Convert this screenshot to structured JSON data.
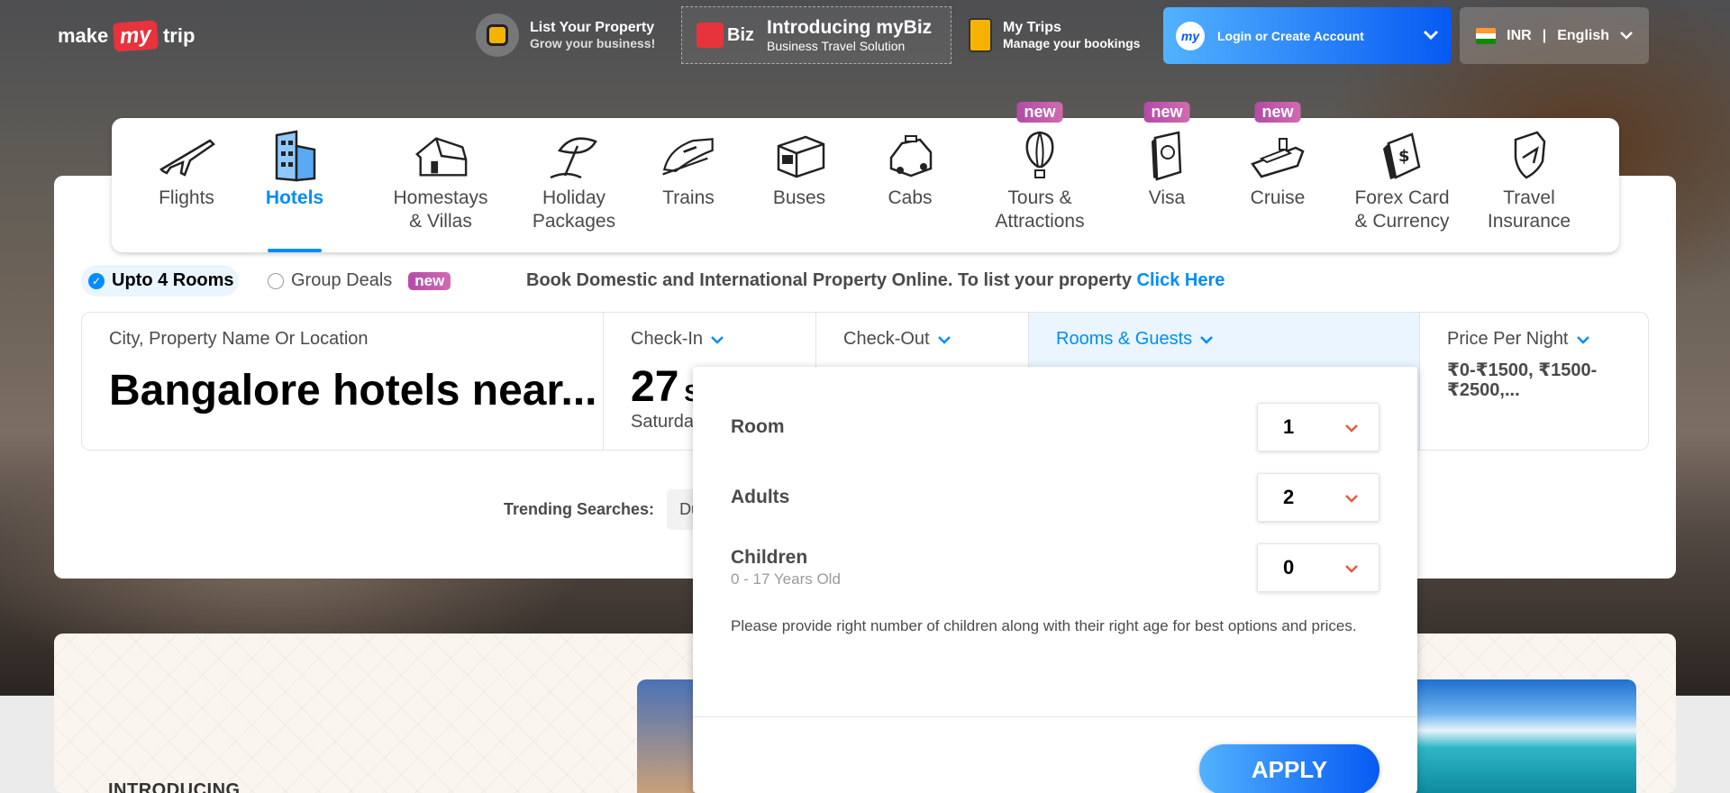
{
  "brand": {
    "make": "make",
    "my": "my",
    "trip": "trip"
  },
  "header": {
    "list_property": {
      "title": "List Your Property",
      "sub": "Grow your business!"
    },
    "mybiz": {
      "logo_text": "Biz",
      "title": "Introducing myBiz",
      "sub": "Business Travel Solution"
    },
    "trips": {
      "title": "My Trips",
      "sub": "Manage your bookings"
    },
    "login": {
      "icon_text": "my",
      "label": "Login or Create Account"
    },
    "locale": {
      "currency": "INR",
      "language": "English"
    }
  },
  "nav": {
    "items": [
      {
        "label": "Flights",
        "icon": "plane-icon"
      },
      {
        "label": "Hotels",
        "icon": "building-icon",
        "active": true
      },
      {
        "label": "Homestays\n& Villas",
        "icon": "house-icon"
      },
      {
        "label": "Holiday\nPackages",
        "icon": "umbrella-icon"
      },
      {
        "label": "Trains",
        "icon": "train-icon"
      },
      {
        "label": "Buses",
        "icon": "bus-icon"
      },
      {
        "label": "Cabs",
        "icon": "car-icon"
      },
      {
        "label": "Tours &\nAttractions",
        "icon": "balloon-icon",
        "badge": "new"
      },
      {
        "label": "Visa",
        "icon": "passport-icon",
        "badge": "new"
      },
      {
        "label": "Cruise",
        "icon": "ship-icon",
        "badge": "new"
      },
      {
        "label": "Forex Card\n& Currency",
        "icon": "currency-card-icon"
      },
      {
        "label": "Travel\nInsurance",
        "icon": "shield-plane-icon"
      }
    ]
  },
  "options": {
    "rooms_option": "Upto 4 Rooms",
    "group_option": "Group Deals",
    "group_badge": "new",
    "promo_text": "Book Domestic and International Property Online. To list your property",
    "promo_link": "Click Here"
  },
  "search": {
    "city": {
      "label": "City, Property Name Or Location",
      "value": "Bangalore hotels near..."
    },
    "checkin": {
      "label": "Check-In",
      "day": "27",
      "month_partial": "S",
      "weekday_partial": "Saturda"
    },
    "checkout": {
      "label": "Check-Out"
    },
    "rooms_guests": {
      "label": "Rooms & Guests"
    },
    "price": {
      "label": "Price Per Night",
      "value": "₹0-₹1500, ₹1500-₹2500,..."
    }
  },
  "trending": {
    "label": "Trending Searches:",
    "chips": [
      "Dub"
    ]
  },
  "lower": {
    "introducing": "INTRODUCING"
  },
  "rooms_panel": {
    "room": {
      "label": "Room",
      "value": "1"
    },
    "adults": {
      "label": "Adults",
      "value": "2"
    },
    "children": {
      "label": "Children",
      "sub": "0 - 17 Years Old",
      "value": "0"
    },
    "note": "Please provide right number of children along with their right age for best options and prices.",
    "apply": "APPLY"
  },
  "colors": {
    "accent": "#008cff",
    "brand_red": "#e7333b",
    "badge": "#b34ba8",
    "chevron": "#e55a40"
  }
}
